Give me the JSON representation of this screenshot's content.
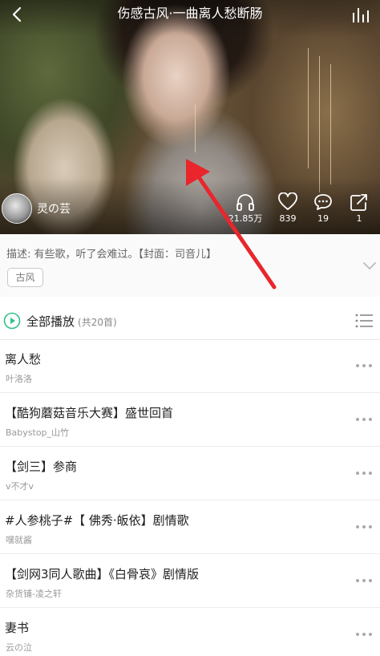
{
  "header": {
    "title": "伤感古风·一曲离人愁断肠"
  },
  "creator": {
    "name": "灵の芸"
  },
  "stats": {
    "listens": "21.85万",
    "likes": "839",
    "comments": "19",
    "shares": "1"
  },
  "description": {
    "text": "描述: 有些歌，听了会难过。【封面：司音儿】",
    "tag": "古风"
  },
  "play_all": {
    "label": "全部播放",
    "count": "(共20首)"
  },
  "songs": [
    {
      "title": "离人愁",
      "artist": "叶洛洛"
    },
    {
      "title": "【酷狗蘑菇音乐大赛】盛世回首",
      "artist": "Babystop_山竹"
    },
    {
      "title": "【剑三】参商",
      "artist": "v不才v"
    },
    {
      "title": "#人参桃子#【 佛秀·皈依】剧情歌",
      "artist": "嘿就酱"
    },
    {
      "title": "【剑网3同人歌曲】《白骨哀》剧情版",
      "artist": "杂货铺-凌之轩"
    },
    {
      "title": "妻书",
      "artist": "云の泣"
    }
  ],
  "colors": {
    "accent": "#2ec28a",
    "annotation_arrow": "#e8262b"
  },
  "icons": {
    "back": "back-icon",
    "equalizer": "equalizer-icon",
    "listens": "headphones-icon",
    "likes": "heart-icon",
    "comments": "comment-icon",
    "shares": "share-icon",
    "expand": "chevron-down-icon",
    "play_all": "play-circle-icon",
    "multi_select": "list-icon",
    "more": "more-icon"
  }
}
